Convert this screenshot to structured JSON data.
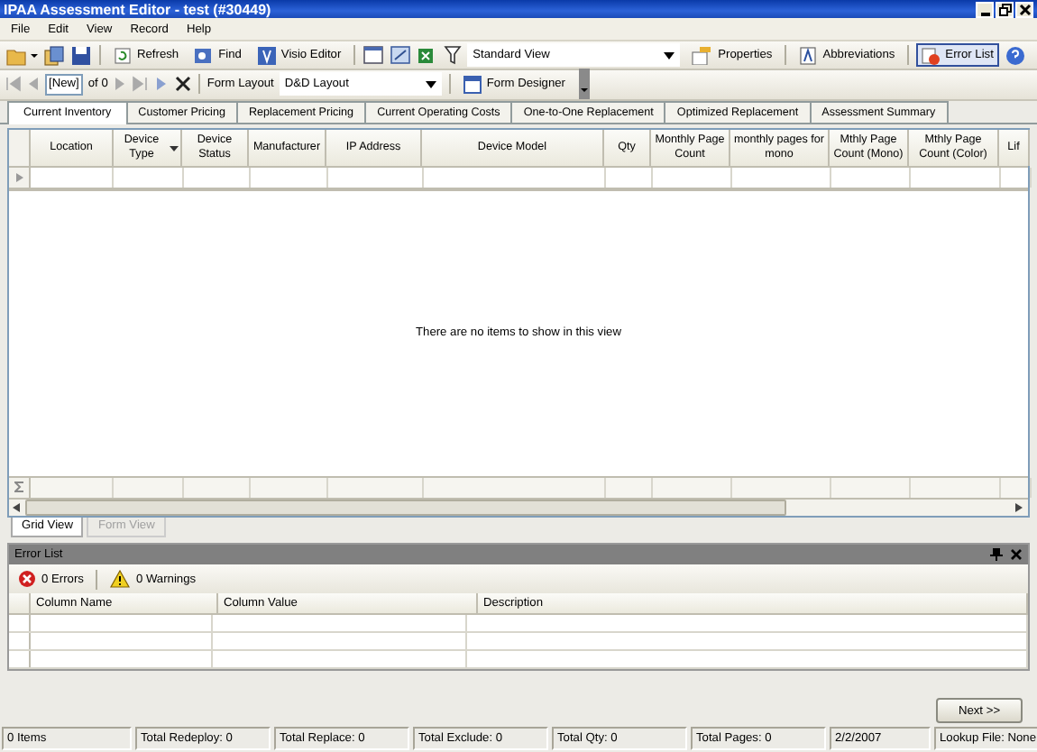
{
  "window": {
    "title": "IPAA Assessment Editor - test (#30449)"
  },
  "menu": [
    "File",
    "Edit",
    "View",
    "Record",
    "Help"
  ],
  "toolbar": {
    "refresh": "Refresh",
    "find": "Find",
    "visio": "Visio Editor",
    "view_combo": "Standard View",
    "properties": "Properties",
    "abbreviations": "Abbreviations",
    "error_list": {
      "label": "Error List",
      "pressed": true
    }
  },
  "navigator": {
    "record": "[New]",
    "of": "of 0",
    "layout_label": "Form Layout",
    "layout_combo": "D&D Layout",
    "designer": "Form Designer"
  },
  "tabs": [
    {
      "label": "Current Inventory",
      "selected": true
    },
    {
      "label": "Customer Pricing",
      "selected": false
    },
    {
      "label": "Replacement Pricing",
      "selected": false
    },
    {
      "label": "Current Operating Costs",
      "selected": false
    },
    {
      "label": "One-to-One Replacement",
      "selected": false
    },
    {
      "label": "Optimized Replacement",
      "selected": false
    },
    {
      "label": "Assessment Summary",
      "selected": false
    }
  ],
  "grid": {
    "columns": [
      {
        "label": "Location"
      },
      {
        "label": "Device Type",
        "sort": true
      },
      {
        "label": "Device Status"
      },
      {
        "label": "Manufacturer"
      },
      {
        "label": "IP Address"
      },
      {
        "label": "Device Model"
      },
      {
        "label": "Qty"
      },
      {
        "label": "Monthly Page Count"
      },
      {
        "label": "monthly pages for mono"
      },
      {
        "label": "Mthly Page Count (Mono)"
      },
      {
        "label": "Mthly Page Count (Color)"
      },
      {
        "label": "Lif"
      }
    ],
    "empty_message": "There are no items to show in this view"
  },
  "view_tabs": [
    {
      "label": "Grid View",
      "selected": true,
      "disabled": false
    },
    {
      "label": "Form View",
      "selected": false,
      "disabled": true
    }
  ],
  "error_list": {
    "title": "Error List",
    "errors": "0 Errors",
    "warnings": "0 Warnings",
    "columns": [
      "Column Name",
      "Column Value",
      "Description"
    ]
  },
  "next_button": "Next >>",
  "status_bar": [
    "0 Items",
    "Total Redeploy: 0",
    "Total Replace: 0",
    "Total Exclude: 0",
    "Total Qty: 0",
    "Total Pages: 0",
    "2/2/2007",
    "Lookup File: None"
  ]
}
